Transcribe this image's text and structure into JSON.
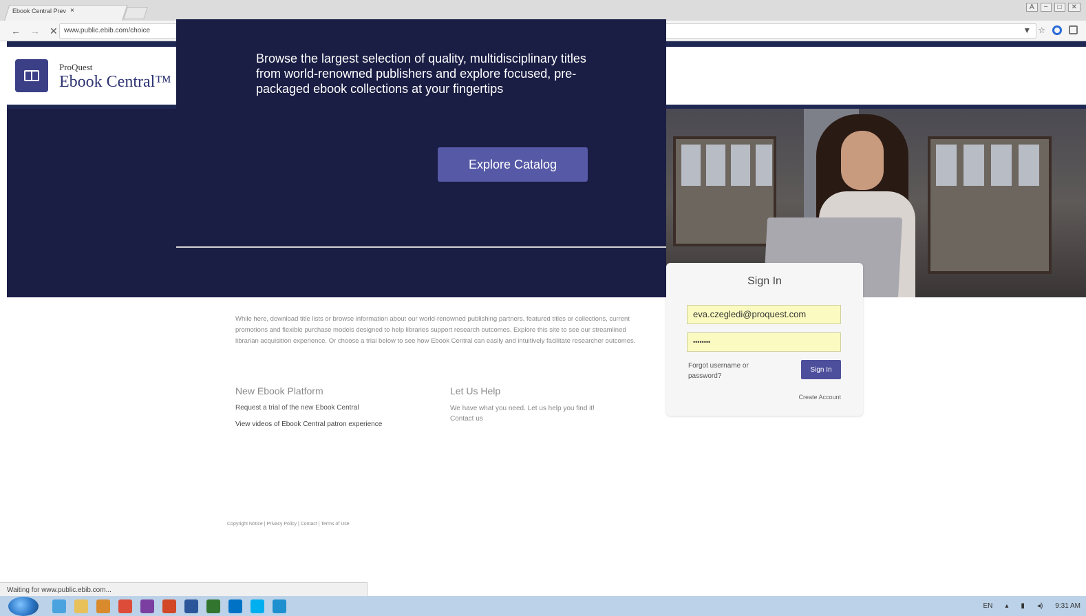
{
  "browser": {
    "tab_title": "Ebook Central Prev",
    "tab_close": "×",
    "url": "www.public.ebib.com/choice",
    "nav": {
      "back": "←",
      "forward": "→",
      "stop": "✕"
    },
    "toolbar_icons": {
      "menu": "▼",
      "star": "☆"
    },
    "window_controls": [
      "A",
      "−",
      "□",
      "✕"
    ]
  },
  "header": {
    "brand_top": "ProQuest",
    "brand_main": "Ebook Central™ P"
  },
  "overlay": {
    "text": "Browse the largest selection of quality, multidisciplinary titles from world-renowned publishers and explore focused, pre-packaged ebook collections at your fingertips",
    "button": "Explore Catalog"
  },
  "content": {
    "intro": "While here, download title lists or browse information about our world-renowned publishing partners, featured titles or collections, current promotions and flexible purchase models designed to help libraries support research outcomes. Explore this site to see our streamlined librarian acquisition experience. Or choose a trial below to see how Ebook Central can easily and intuitively facilitate researcher outcomes.",
    "col1": {
      "heading": "New Ebook Platform",
      "link1": "Request a trial of the new Ebook Central",
      "link2": "View videos of Ebook Central patron experience"
    },
    "col2": {
      "heading": "Let Us Help",
      "text": "We have what you need. Let us help you find it! Contact us"
    },
    "footer": "Copyright Notice | Privacy Policy | Contact | Terms of Use"
  },
  "signin": {
    "title": "Sign In",
    "username": "eva.czegledi@proquest.com",
    "password": "••••••••",
    "forgot": "Forgot username or password?",
    "button": "Sign In",
    "create": "Create Account"
  },
  "status": {
    "text": "Waiting for www.public.ebib.com..."
  },
  "taskbar": {
    "lang": "EN",
    "time": "9:31 AM",
    "apps": [
      "ie-icon",
      "folder-icon",
      "media-icon",
      "chrome-icon",
      "onenote-icon",
      "powerpoint-icon",
      "word-icon",
      "project-icon",
      "outlook-icon",
      "skype-icon",
      "lync-icon"
    ],
    "app_colors": [
      "#4aa3df",
      "#e8c15a",
      "#d88a2c",
      "#dd4b39",
      "#7a3fa0",
      "#d24726",
      "#2b579a",
      "#31752f",
      "#0072c6",
      "#00aff0",
      "#1e90d0"
    ]
  }
}
